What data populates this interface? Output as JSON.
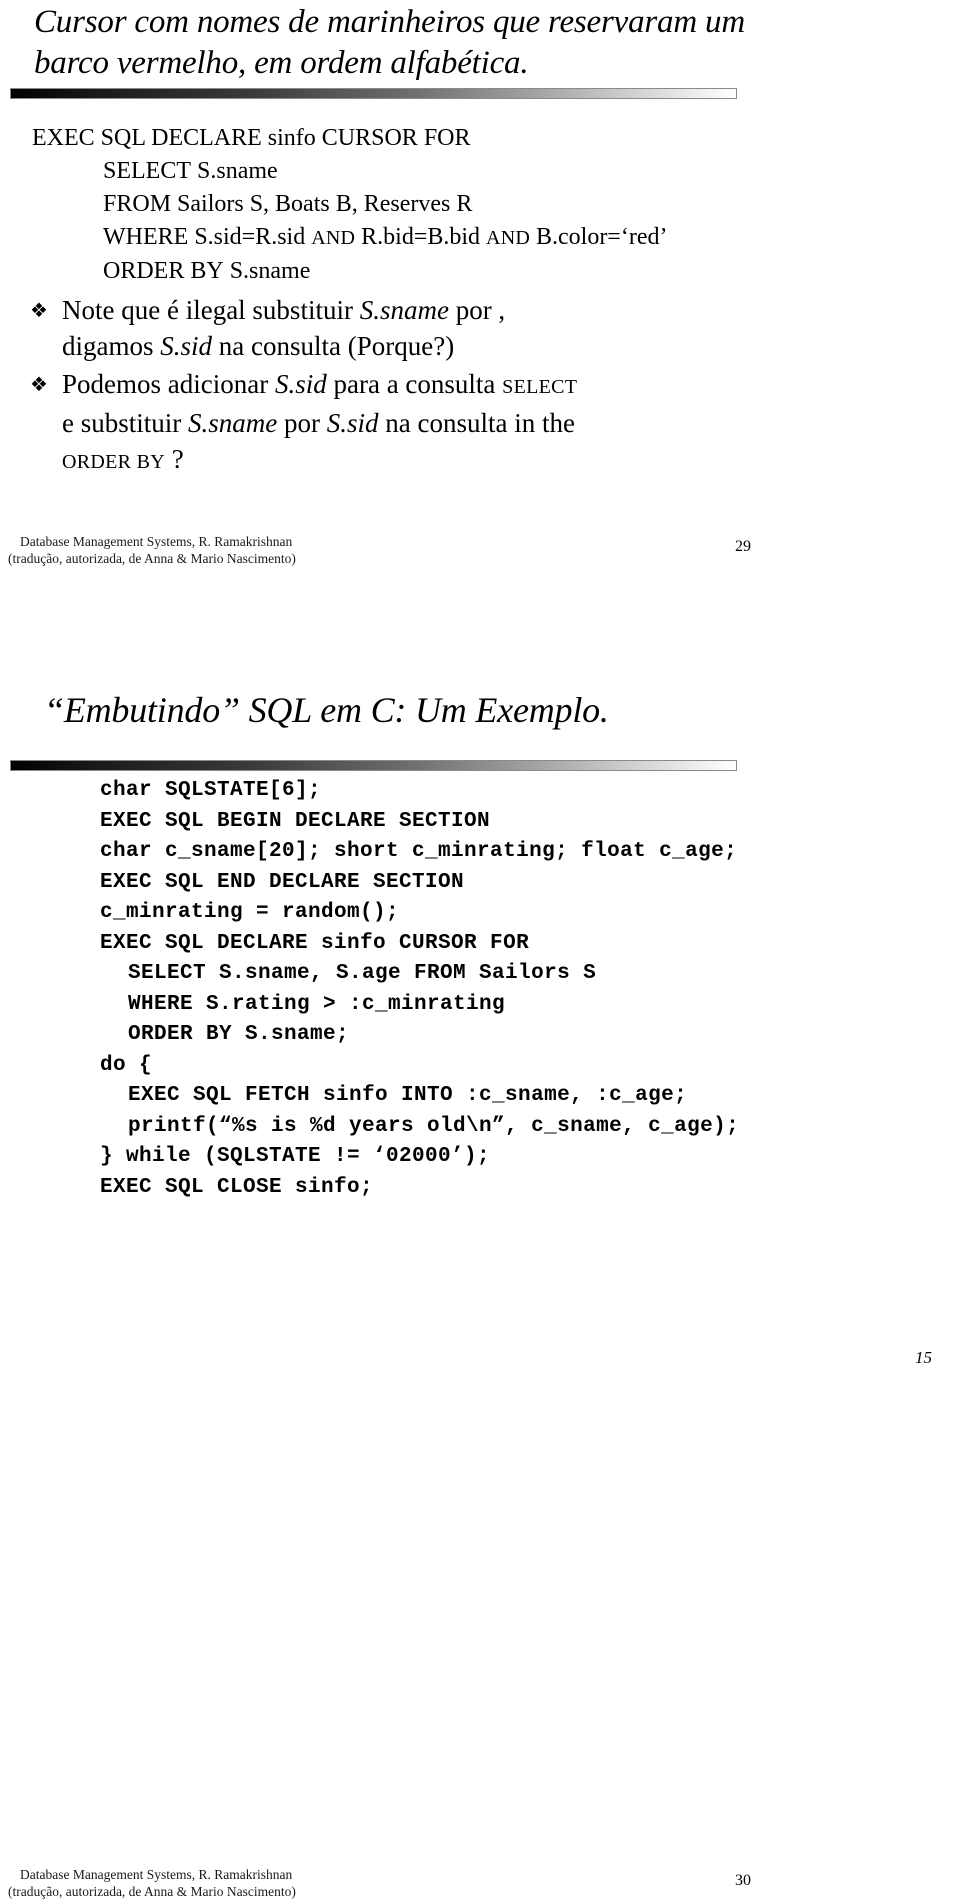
{
  "document": {
    "page_number": "15"
  },
  "slides": [
    {
      "id": "slide-cursor-sailors",
      "title": "Cursor com nomes de marinheiros que reservaram um barco vermelho, em ordem alfabética.",
      "sql": {
        "line1_kw": "EXEC SQL DECLARE",
        "line1_id": " sinfo ",
        "line1_kw2": "CURSOR FOR",
        "line2_kw": "SELECT",
        "line2_rest": "  S.sname",
        "line3_kw": "FROM",
        "line3_rest": "  Sailors S, Boats B, Reserves R",
        "line4_kw": "WHERE",
        "line4_a": "  S.sid=R.sid ",
        "line4_and1": "AND",
        "line4_b": " R.bid=B.bid ",
        "line4_and2": "AND",
        "line4_c": " B.color=‘red’",
        "line5_kw": "ORDER BY",
        "line5_rest": "  S.sname"
      },
      "bullets": [
        {
          "marker": "❖",
          "part1": "Note que é ilegal substituir  ",
          "italic1": "S.sname",
          "part2": " por ,",
          "part3": "digamos ",
          "italic2": "S.sid",
          "part4": "  na consulta  (Porque?)"
        },
        {
          "marker": "❖",
          "part1": "Podemos adicionar ",
          "italic1": "S.sid",
          "part2": "  para a consulta  ",
          "smallcaps1": "SELECT",
          "part3": "e substituir ",
          "italic2": "S.sname",
          "part4": " por ",
          "italic3": "S.sid",
          "part5": "  na consulta in the",
          "smallcaps2": "ORDER BY",
          "part6": " ?"
        }
      ],
      "footer": {
        "line1": "Database Management Systems, R. Ramakrishnan",
        "line2": "(tradução, autorizada, de Anna & Mario Nascimento)",
        "slide_number": "29"
      }
    },
    {
      "id": "slide-embedding-sql-c",
      "title": "“Embutindo” SQL em C: Um Exemplo.",
      "code": [
        {
          "indent": 0,
          "text": "char SQLSTATE[6];"
        },
        {
          "indent": 0,
          "text": "EXEC SQL BEGIN DECLARE SECTION"
        },
        {
          "indent": 0,
          "text": "char c_sname[20]; short c_minrating; float c_age;"
        },
        {
          "indent": 0,
          "text": "EXEC SQL END DECLARE SECTION"
        },
        {
          "indent": 0,
          "text": "c_minrating = random();"
        },
        {
          "indent": 0,
          "text": "EXEC SQL DECLARE sinfo CURSOR FOR"
        },
        {
          "indent": 1,
          "text": "SELECT S.sname, S.age FROM Sailors S"
        },
        {
          "indent": 1,
          "text": "WHERE S.rating > :c_minrating"
        },
        {
          "indent": 1,
          "text": "ORDER BY S.sname;"
        },
        {
          "indent": 0,
          "text": "do {"
        },
        {
          "indent": 1,
          "text": "EXEC SQL FETCH sinfo INTO :c_sname, :c_age;"
        },
        {
          "indent": 1,
          "text": "printf(“%s is %d years old\\n”, c_sname, c_age);"
        },
        {
          "indent": 0,
          "text": "} while (SQLSTATE != ‘02000’);"
        },
        {
          "indent": 0,
          "text": "EXEC SQL CLOSE sinfo;"
        }
      ],
      "footer": {
        "line1": "Database Management Systems, R. Ramakrishnan",
        "line2": "(tradução, autorizada, de Anna & Mario Nascimento)",
        "slide_number": "30"
      }
    }
  ]
}
